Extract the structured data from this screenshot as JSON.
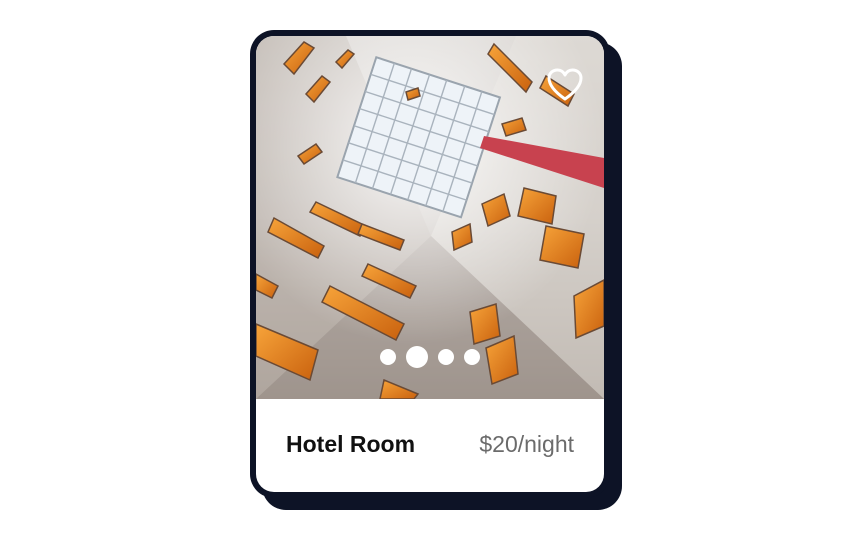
{
  "listing": {
    "title": "Hotel Room",
    "price": "$20/night",
    "favorite_icon": "heart-icon"
  },
  "carousel": {
    "slide_count": 4,
    "active_index": 1
  },
  "colors": {
    "card_border": "#0d1326",
    "title": "#111111",
    "price": "#6b6b6b",
    "accent_window": "#f08a1f",
    "beam": "#c8424f"
  }
}
